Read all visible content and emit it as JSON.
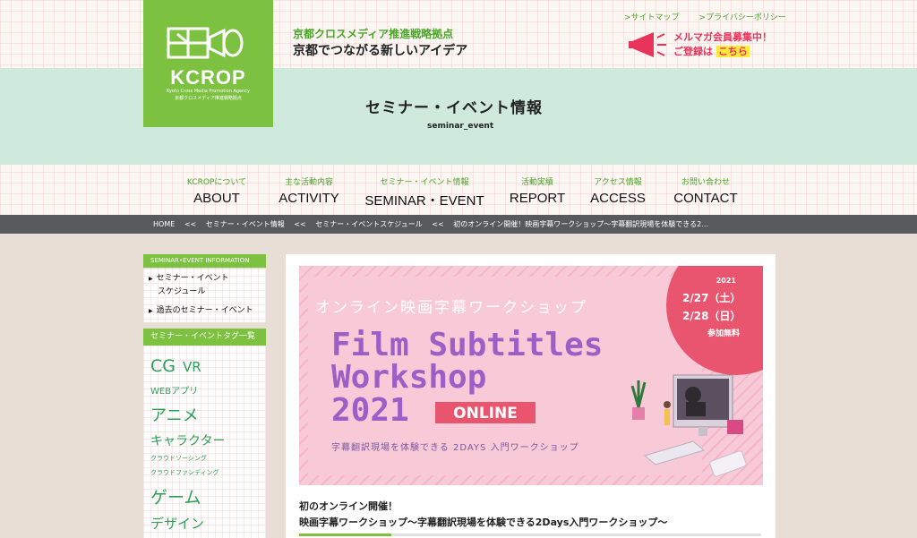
{
  "logo": {
    "word": "KCROP",
    "sub1": "Kyoto Cross Media Promotion Agency",
    "sub2": "京都クロスメディア推進戦略拠点"
  },
  "header": {
    "tagline1": "京都クロスメディア推進戦略拠点",
    "tagline2": "京都でつながる新しいアイデア",
    "links": [
      ">サイトマップ",
      ">プライバシーポリシー"
    ],
    "mail_line1": "メルマガ会員募集中！",
    "mail_line2_prefix": "ご登録は",
    "mail_line2_link": "こちら"
  },
  "page": {
    "title": "セミナー・イベント情報",
    "subtitle": "seminar_event"
  },
  "nav": [
    {
      "jp": "KCROPについて",
      "en": "ABOUT"
    },
    {
      "jp": "主な活動内容",
      "en": "ACTIVITY"
    },
    {
      "jp": "セミナー・イベント情報",
      "en": "SEMINAR・EVENT"
    },
    {
      "jp": "活動実績",
      "en": "REPORT"
    },
    {
      "jp": "アクセス情報",
      "en": "ACCESS"
    },
    {
      "jp": "お問い合わせ",
      "en": "CONTACT"
    }
  ],
  "breadcrumb": {
    "items": [
      "HOME",
      "セミナー・イベント情報",
      "セミナー・イベントスケジュール",
      "初のオンライン開催！映画字幕ワークショップ〜字幕翻訳現場を体験できる2…"
    ],
    "separator": "<<"
  },
  "sidebar": {
    "info_heading": "SEMINAR•EVENT INFORMATION",
    "info_items": [
      "セミナー・イベント",
      "スケジュール",
      "過去のセミナー・イベント"
    ],
    "tag_heading": "セミナー・イベントタグ一覧",
    "tags": [
      "CG",
      "VR",
      "WEBアプリ",
      "アニメ",
      "キャラクター",
      "クラウドソーシング",
      "クラウドファンディング",
      "ゲーム",
      "デザイン"
    ]
  },
  "banner": {
    "jp_title": "オンライン映画字幕ワークショップ",
    "line1": "Film Subtitles",
    "line2": "Workshop",
    "line3": "2021",
    "badge": "ONLINE",
    "tagline": "字幕翻訳現場を体験できる 2DAYS 入門ワークショップ",
    "year": "2021",
    "date1": "2/27（土）",
    "date2": "2/28（日）",
    "free": "参加無料",
    "colors": {
      "bg": "#f8c9d6",
      "purple": "#9b5fc6",
      "pink": "#e9556e"
    }
  },
  "news": {
    "line1": "初のオンライン開催！",
    "line2": "映画字幕ワークショップ〜字幕翻訳現場を体験できる2Days入門ワークショップ〜"
  },
  "slider": {
    "progress": 0.2
  },
  "colors": {
    "green": "#7cc13f",
    "mint": "#cfeadd",
    "dark": "#58595b",
    "pink": "#e8335b"
  }
}
